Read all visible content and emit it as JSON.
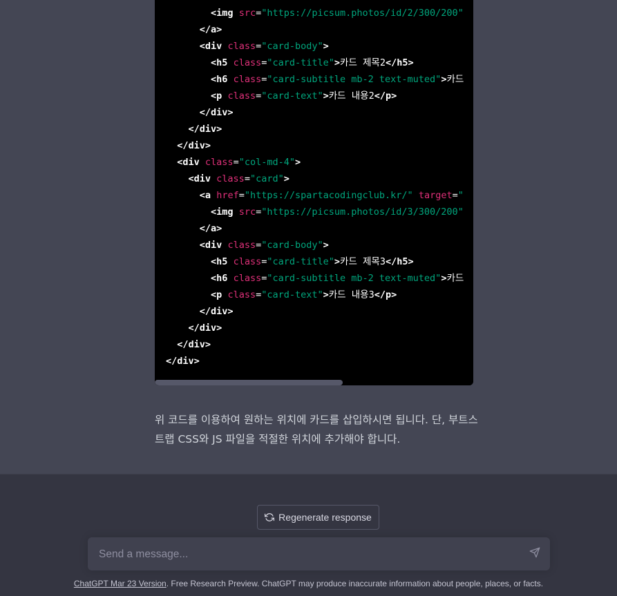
{
  "colors": {
    "page_background": "#444654",
    "code_background": "#000000",
    "tag": "#ffffff",
    "attribute": "#df3079",
    "string": "#00a67d",
    "text": "#ffffff",
    "input_background": "#40414f",
    "bottom_background": "#343541"
  },
  "code": {
    "lines": [
      [
        {
          "t": "ind",
          "v": "        "
        },
        {
          "t": "tag",
          "v": "<img"
        },
        {
          "t": "text",
          "v": " "
        },
        {
          "t": "attr",
          "v": "src"
        },
        {
          "t": "punct",
          "v": "="
        },
        {
          "t": "str",
          "v": "\"https://picsum.photos/id/2/300/200\""
        }
      ],
      [
        {
          "t": "ind",
          "v": "      "
        },
        {
          "t": "tag",
          "v": "</a>"
        }
      ],
      [
        {
          "t": "ind",
          "v": "      "
        },
        {
          "t": "tag",
          "v": "<div"
        },
        {
          "t": "text",
          "v": " "
        },
        {
          "t": "attr",
          "v": "class"
        },
        {
          "t": "punct",
          "v": "="
        },
        {
          "t": "str",
          "v": "\"card-body\""
        },
        {
          "t": "tag",
          "v": ">"
        }
      ],
      [
        {
          "t": "ind",
          "v": "        "
        },
        {
          "t": "tag",
          "v": "<h5"
        },
        {
          "t": "text",
          "v": " "
        },
        {
          "t": "attr",
          "v": "class"
        },
        {
          "t": "punct",
          "v": "="
        },
        {
          "t": "str",
          "v": "\"card-title\""
        },
        {
          "t": "tag",
          "v": ">"
        },
        {
          "t": "text",
          "v": "카드 제목2"
        },
        {
          "t": "tag",
          "v": "</h5>"
        }
      ],
      [
        {
          "t": "ind",
          "v": "        "
        },
        {
          "t": "tag",
          "v": "<h6"
        },
        {
          "t": "text",
          "v": " "
        },
        {
          "t": "attr",
          "v": "class"
        },
        {
          "t": "punct",
          "v": "="
        },
        {
          "t": "str",
          "v": "\"card-subtitle mb-2 text-muted\""
        },
        {
          "t": "tag",
          "v": ">"
        },
        {
          "t": "text",
          "v": "카드"
        }
      ],
      [
        {
          "t": "ind",
          "v": "        "
        },
        {
          "t": "tag",
          "v": "<p"
        },
        {
          "t": "text",
          "v": " "
        },
        {
          "t": "attr",
          "v": "class"
        },
        {
          "t": "punct",
          "v": "="
        },
        {
          "t": "str",
          "v": "\"card-text\""
        },
        {
          "t": "tag",
          "v": ">"
        },
        {
          "t": "text",
          "v": "카드 내용2"
        },
        {
          "t": "tag",
          "v": "</p>"
        }
      ],
      [
        {
          "t": "ind",
          "v": "      "
        },
        {
          "t": "tag",
          "v": "</div>"
        }
      ],
      [
        {
          "t": "ind",
          "v": "    "
        },
        {
          "t": "tag",
          "v": "</div>"
        }
      ],
      [
        {
          "t": "ind",
          "v": "  "
        },
        {
          "t": "tag",
          "v": "</div>"
        }
      ],
      [
        {
          "t": "ind",
          "v": "  "
        },
        {
          "t": "tag",
          "v": "<div"
        },
        {
          "t": "text",
          "v": " "
        },
        {
          "t": "attr",
          "v": "class"
        },
        {
          "t": "punct",
          "v": "="
        },
        {
          "t": "str",
          "v": "\"col-md-4\""
        },
        {
          "t": "tag",
          "v": ">"
        }
      ],
      [
        {
          "t": "ind",
          "v": "    "
        },
        {
          "t": "tag",
          "v": "<div"
        },
        {
          "t": "text",
          "v": " "
        },
        {
          "t": "attr",
          "v": "class"
        },
        {
          "t": "punct",
          "v": "="
        },
        {
          "t": "str",
          "v": "\"card\""
        },
        {
          "t": "tag",
          "v": ">"
        }
      ],
      [
        {
          "t": "ind",
          "v": "      "
        },
        {
          "t": "tag",
          "v": "<a"
        },
        {
          "t": "text",
          "v": " "
        },
        {
          "t": "attr",
          "v": "href"
        },
        {
          "t": "punct",
          "v": "="
        },
        {
          "t": "str",
          "v": "\"https://spartacodingclub.kr/\""
        },
        {
          "t": "text",
          "v": " "
        },
        {
          "t": "attr",
          "v": "target"
        },
        {
          "t": "punct",
          "v": "="
        },
        {
          "t": "str",
          "v": "\""
        }
      ],
      [
        {
          "t": "ind",
          "v": "        "
        },
        {
          "t": "tag",
          "v": "<img"
        },
        {
          "t": "text",
          "v": " "
        },
        {
          "t": "attr",
          "v": "src"
        },
        {
          "t": "punct",
          "v": "="
        },
        {
          "t": "str",
          "v": "\"https://picsum.photos/id/3/300/200\""
        }
      ],
      [
        {
          "t": "ind",
          "v": "      "
        },
        {
          "t": "tag",
          "v": "</a>"
        }
      ],
      [
        {
          "t": "ind",
          "v": "      "
        },
        {
          "t": "tag",
          "v": "<div"
        },
        {
          "t": "text",
          "v": " "
        },
        {
          "t": "attr",
          "v": "class"
        },
        {
          "t": "punct",
          "v": "="
        },
        {
          "t": "str",
          "v": "\"card-body\""
        },
        {
          "t": "tag",
          "v": ">"
        }
      ],
      [
        {
          "t": "ind",
          "v": "        "
        },
        {
          "t": "tag",
          "v": "<h5"
        },
        {
          "t": "text",
          "v": " "
        },
        {
          "t": "attr",
          "v": "class"
        },
        {
          "t": "punct",
          "v": "="
        },
        {
          "t": "str",
          "v": "\"card-title\""
        },
        {
          "t": "tag",
          "v": ">"
        },
        {
          "t": "text",
          "v": "카드 제목3"
        },
        {
          "t": "tag",
          "v": "</h5>"
        }
      ],
      [
        {
          "t": "ind",
          "v": "        "
        },
        {
          "t": "tag",
          "v": "<h6"
        },
        {
          "t": "text",
          "v": " "
        },
        {
          "t": "attr",
          "v": "class"
        },
        {
          "t": "punct",
          "v": "="
        },
        {
          "t": "str",
          "v": "\"card-subtitle mb-2 text-muted\""
        },
        {
          "t": "tag",
          "v": ">"
        },
        {
          "t": "text",
          "v": "카드"
        }
      ],
      [
        {
          "t": "ind",
          "v": "        "
        },
        {
          "t": "tag",
          "v": "<p"
        },
        {
          "t": "text",
          "v": " "
        },
        {
          "t": "attr",
          "v": "class"
        },
        {
          "t": "punct",
          "v": "="
        },
        {
          "t": "str",
          "v": "\"card-text\""
        },
        {
          "t": "tag",
          "v": ">"
        },
        {
          "t": "text",
          "v": "카드 내용3"
        },
        {
          "t": "tag",
          "v": "</p>"
        }
      ],
      [
        {
          "t": "ind",
          "v": "      "
        },
        {
          "t": "tag",
          "v": "</div>"
        }
      ],
      [
        {
          "t": "ind",
          "v": "    "
        },
        {
          "t": "tag",
          "v": "</div>"
        }
      ],
      [
        {
          "t": "ind",
          "v": "  "
        },
        {
          "t": "tag",
          "v": "</div>"
        }
      ],
      [
        {
          "t": "ind",
          "v": ""
        },
        {
          "t": "tag",
          "v": "</div>"
        }
      ]
    ]
  },
  "answer": {
    "text": "위 코드를 이용하여 원하는 위치에 카드를 삽입하시면 됩니다. 단, 부트스트랩 CSS와 JS 파일을 적절한 위치에 추가해야 합니다."
  },
  "regenerate": {
    "label": "Regenerate response",
    "icon": "refresh-icon"
  },
  "composer": {
    "placeholder": "Send a message...",
    "send_icon": "paper-plane-icon"
  },
  "footer": {
    "link_text": "ChatGPT Mar 23 Version",
    "rest_text": ". Free Research Preview. ChatGPT may produce inaccurate information about people, places, or facts."
  }
}
